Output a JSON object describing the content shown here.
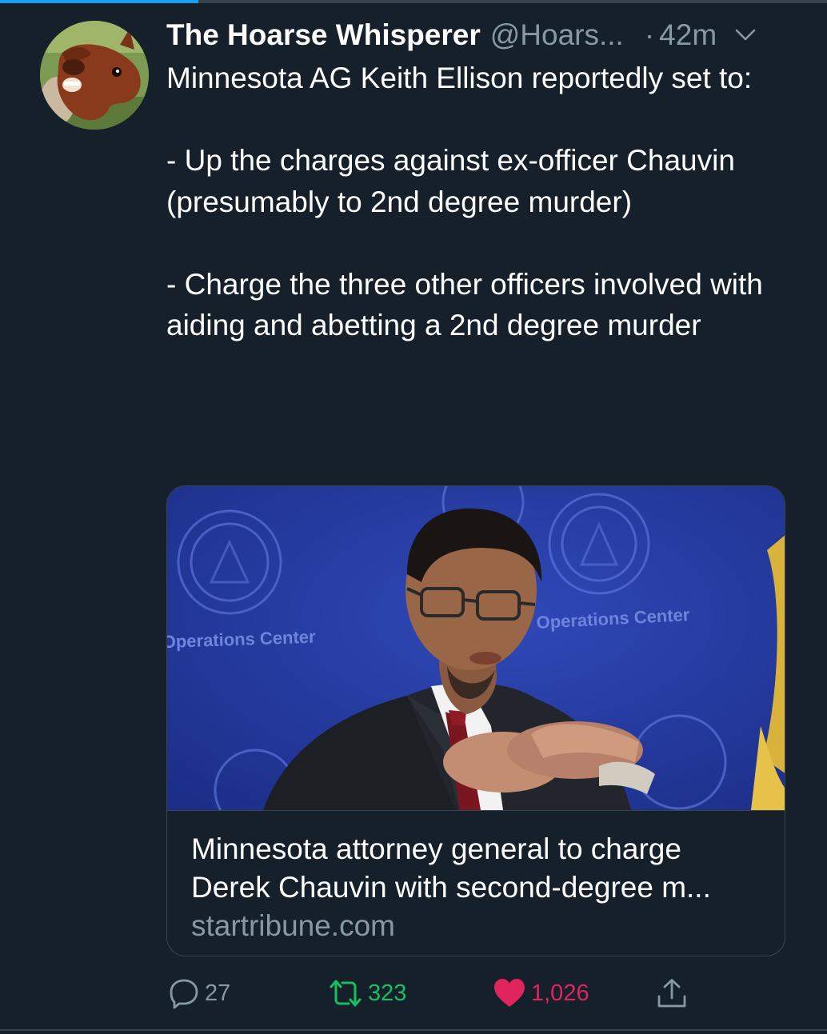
{
  "tweet": {
    "display_name": "The Hoarse Whisperer",
    "handle": "@Hoars...",
    "separator": "·",
    "time": "42m",
    "text_lines": [
      "Minnesota AG Keith Ellison reportedly set to:",
      "",
      "- Up the charges against ex-officer Chauvin (presumably to 2nd degree murder)",
      "",
      "- Charge the three other officers involved with aiding and abetting a 2nd degree murder"
    ],
    "avatar_icon": "horse-avatar-icon",
    "menu_icon": "chevron-down-icon"
  },
  "card": {
    "title": "Minnesota attorney general to charge Derek Chauvin with second-degree m...",
    "domain": "startribune.com",
    "image_backdrop_text": "Operations Center",
    "image_backdrop_text_2": "Operations Center"
  },
  "actions": {
    "reply": {
      "icon": "reply-icon",
      "count": "27",
      "color": "#8899a6"
    },
    "retweet": {
      "icon": "retweet-icon",
      "count": "323",
      "color": "#17bf63"
    },
    "like": {
      "icon": "heart-icon",
      "count": "1,026",
      "color": "#e0245e"
    },
    "share": {
      "icon": "share-icon",
      "color": "#8899a6"
    }
  },
  "loading_progress": 0.24,
  "colors": {
    "background": "#15202b",
    "text": "#ffffff",
    "secondary_text": "#8899a6",
    "border": "#38444d",
    "accent": "#1da1f2"
  }
}
